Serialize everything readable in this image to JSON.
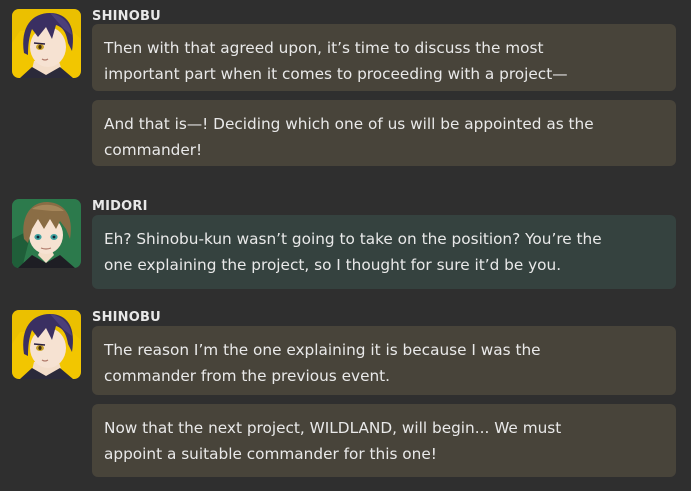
{
  "chat": {
    "messages": [
      {
        "speaker": "SHINOBU",
        "avatar_icon": "shinobu-avatar-icon",
        "bubble_color": "#48443a",
        "avatar_bg": "#f0c800",
        "lines": [
          [
            "Then with that agreed upon, it’s time to discuss the most",
            "important part when it comes to proceeding with a project—"
          ],
          [
            "And that is—! Deciding which one of us will be appointed as the",
            "commander!"
          ]
        ]
      },
      {
        "speaker": "MIDORI",
        "avatar_icon": "midori-avatar-icon",
        "bubble_color": "#35423f",
        "avatar_bg": "#2e7d4f",
        "lines": [
          [
            "Eh? Shinobu-kun wasn’t going to take on the position? You’re the",
            "one explaining the project, so I thought for sure it’d be you."
          ]
        ]
      },
      {
        "speaker": "SHINOBU",
        "avatar_icon": "shinobu-avatar-icon",
        "bubble_color": "#48443a",
        "avatar_bg": "#f0c800",
        "lines": [
          [
            "The reason I’m the one explaining it is because I was the",
            "commander from the previous event."
          ],
          [
            "Now that the next project, WILDLAND, will begin... We must",
            "appoint a suitable commander for this one!"
          ]
        ]
      }
    ]
  }
}
